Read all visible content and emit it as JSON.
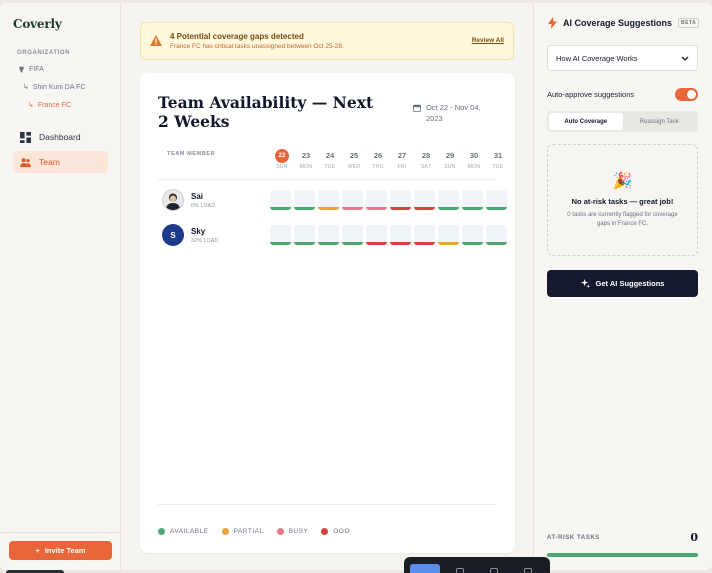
{
  "app": {
    "name": "Coverly"
  },
  "sidebar": {
    "org_label": "ORGANIZATION",
    "tree": [
      {
        "label": "FIFA",
        "level": 0,
        "active": false
      },
      {
        "label": "Shin Kuni DA FC",
        "level": 1,
        "active": false
      },
      {
        "label": "France FC",
        "level": 2,
        "active": true
      }
    ],
    "nav": [
      {
        "label": "Dashboard",
        "icon": "dashboard-icon",
        "active": false
      },
      {
        "label": "Team",
        "icon": "team-icon",
        "active": true
      }
    ],
    "invite_label": "Invite Team"
  },
  "alert": {
    "title": "4 Potential coverage gaps detected",
    "subtitle": "France FC has critical tasks unassigned between Oct 25-28.",
    "link": "Review All"
  },
  "availability": {
    "title": "Team Availability — Next 2 Weeks",
    "date_range": "Oct 22 - Nov 04, 2023",
    "member_header": "TEAM MEMBER",
    "days": [
      {
        "num": "22",
        "name": "SUN",
        "today": true
      },
      {
        "num": "23",
        "name": "MON"
      },
      {
        "num": "24",
        "name": "TUE"
      },
      {
        "num": "25",
        "name": "WED"
      },
      {
        "num": "26",
        "name": "THU"
      },
      {
        "num": "27",
        "name": "FRI"
      },
      {
        "num": "28",
        "name": "SAT"
      },
      {
        "num": "29",
        "name": "SUN"
      },
      {
        "num": "30",
        "name": "MON"
      },
      {
        "num": "31",
        "name": "TUE"
      }
    ],
    "members": [
      {
        "name": "Sai",
        "load": "0% LOAD",
        "avatar": "photo",
        "initial": "",
        "status": [
          "available",
          "available",
          "partial",
          "busy",
          "busy",
          "ooo",
          "ooo",
          "available",
          "available",
          "available"
        ]
      },
      {
        "name": "Sky",
        "load": "32% LOAD",
        "avatar": "initial",
        "initial": "S",
        "status": [
          "available",
          "available",
          "available",
          "available",
          "ooo",
          "ooo",
          "ooo",
          "partial",
          "available",
          "available"
        ]
      }
    ],
    "legend": [
      {
        "label": "AVAILABLE",
        "key": "available"
      },
      {
        "label": "PARTIAL",
        "key": "partial"
      },
      {
        "label": "BUSY",
        "key": "busy"
      },
      {
        "label": "OOO",
        "key": "ooo"
      }
    ],
    "colors": {
      "available": "#4aa870",
      "partial": "#e8a23a",
      "busy": "#e57a8a",
      "ooo": "#d2453f"
    }
  },
  "ai_panel": {
    "title": "AI Coverage Suggestions",
    "beta": "BETA",
    "how_label": "How AI Coverage Works",
    "auto_approve_label": "Auto-approve suggestions",
    "auto_approve_on": true,
    "tabs": [
      {
        "label": "Auto Coverage",
        "active": true
      },
      {
        "label": "Reassign Task",
        "active": false
      }
    ],
    "empty_emoji": "🎉",
    "empty_title": "No at-risk tasks — great job!",
    "empty_sub": "0 tasks are currently flagged for coverage gaps in France FC.",
    "button_label": "Get AI Suggestions",
    "at_risk_label": "AT-RISK TASKS",
    "at_risk_count": "0"
  },
  "theme": {
    "accent": "#e8663a",
    "dark": "#141a2e",
    "success": "#4aa870"
  }
}
